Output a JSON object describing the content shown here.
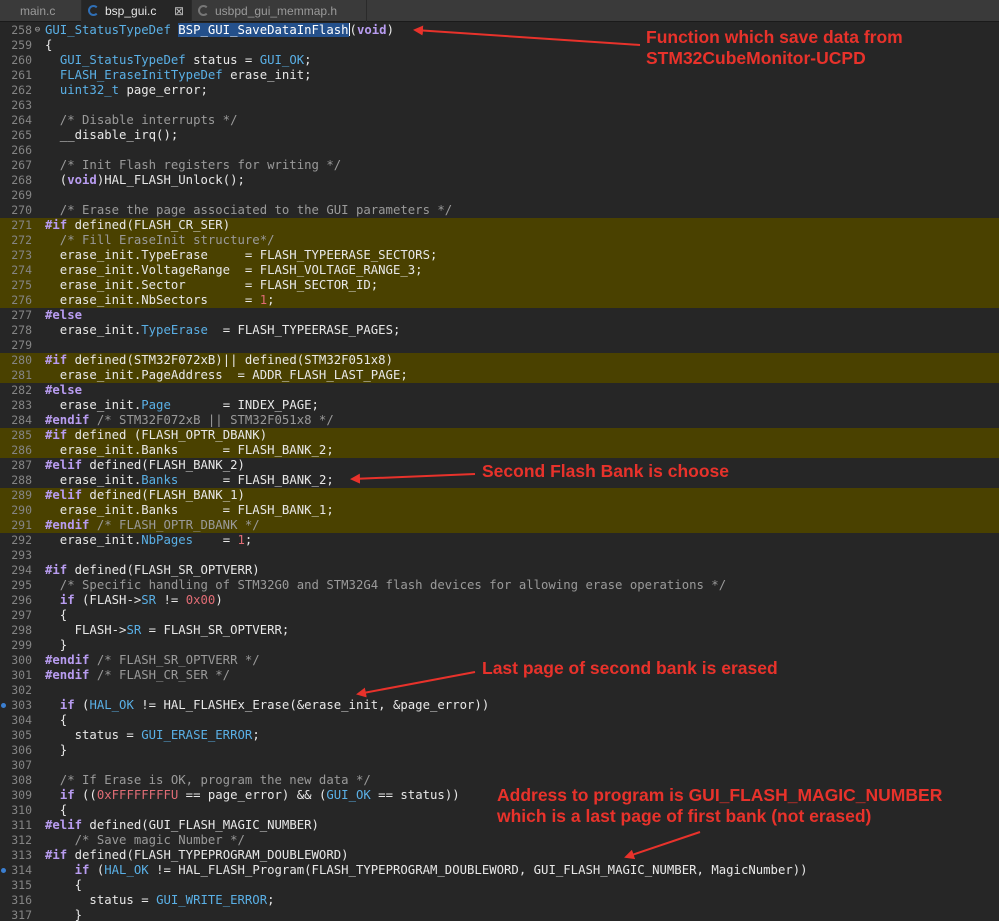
{
  "tabs": [
    {
      "label": "main.c",
      "active": false
    },
    {
      "label": "bsp_gui.c",
      "active": true,
      "close": "⊠"
    },
    {
      "label": "usbpd_gui_memmap.h",
      "active": false
    }
  ],
  "colors": {
    "highlight": "#4a4100",
    "annotation": "#e8322b",
    "keyword": "#b89cf0"
  },
  "lines": [
    {
      "n": "258",
      "m": "⊖",
      "s": [
        [
          "GUI_StatusTypeDef ",
          "ty"
        ],
        [
          "BSP_GUI_SaveDataInFlash",
          "sel"
        ],
        [
          "|",
          "caret"
        ],
        [
          "(",
          "p"
        ],
        [
          "void",
          "kw"
        ],
        [
          ")",
          "p"
        ]
      ]
    },
    {
      "n": "259",
      "s": [
        [
          "{",
          ""
        ]
      ]
    },
    {
      "n": "260",
      "s": [
        [
          "  ",
          ""
        ],
        [
          "GUI_StatusTypeDef",
          "ty"
        ],
        [
          " status = ",
          ""
        ],
        [
          "GUI_OK",
          "mac"
        ],
        [
          ";",
          ""
        ]
      ]
    },
    {
      "n": "261",
      "s": [
        [
          "  ",
          ""
        ],
        [
          "FLASH_EraseInitTypeDef",
          "ty"
        ],
        [
          " erase_init;",
          ""
        ]
      ]
    },
    {
      "n": "262",
      "s": [
        [
          "  ",
          ""
        ],
        [
          "uint32_t",
          "ty"
        ],
        [
          " page_error;",
          ""
        ]
      ]
    },
    {
      "n": "263",
      "s": []
    },
    {
      "n": "264",
      "s": [
        [
          "  /* Disable interrupts */",
          "cm"
        ]
      ]
    },
    {
      "n": "265",
      "s": [
        [
          "  __disable_irq();",
          ""
        ]
      ]
    },
    {
      "n": "266",
      "s": []
    },
    {
      "n": "267",
      "s": [
        [
          "  /* Init Flash registers for writing */",
          "cm"
        ]
      ]
    },
    {
      "n": "268",
      "s": [
        [
          "  (",
          ""
        ],
        [
          "void",
          "kw"
        ],
        [
          ")HAL_FLASH_Unlock();",
          ""
        ]
      ]
    },
    {
      "n": "269",
      "s": []
    },
    {
      "n": "270",
      "s": [
        [
          "  /* Erase the page associated to the GUI parameters */",
          "cm"
        ]
      ]
    },
    {
      "n": "271",
      "h": true,
      "s": [
        [
          "#if",
          "pp"
        ],
        [
          " defined(FLASH_CR_SER)",
          ""
        ]
      ]
    },
    {
      "n": "272",
      "h": true,
      "s": [
        [
          "  /* Fill EraseInit structure*/",
          "cm"
        ]
      ]
    },
    {
      "n": "273",
      "h": true,
      "s": [
        [
          "  erase_init.TypeErase     = FLASH_TYPEERASE_SECTORS;",
          ""
        ]
      ]
    },
    {
      "n": "274",
      "h": true,
      "s": [
        [
          "  erase_init.VoltageRange  = FLASH_VOLTAGE_RANGE_3;",
          ""
        ]
      ]
    },
    {
      "n": "275",
      "h": true,
      "s": [
        [
          "  erase_init.Sector        = FLASH_SECTOR_ID;",
          ""
        ]
      ]
    },
    {
      "n": "276",
      "h": true,
      "s": [
        [
          "  erase_init.NbSectors     = ",
          ""
        ],
        [
          "1",
          "num"
        ],
        [
          ";",
          ""
        ]
      ]
    },
    {
      "n": "277",
      "s": [
        [
          "#else",
          "pp"
        ]
      ]
    },
    {
      "n": "278",
      "s": [
        [
          "  erase_init.",
          ""
        ],
        [
          "TypeErase",
          "mac"
        ],
        [
          "  = FLASH_TYPEERASE_PAGES;",
          ""
        ]
      ]
    },
    {
      "n": "279",
      "s": []
    },
    {
      "n": "280",
      "h": true,
      "s": [
        [
          "#if",
          "pp"
        ],
        [
          " defined(STM32F072xB)|| defined(STM32F051x8)",
          ""
        ]
      ]
    },
    {
      "n": "281",
      "h": true,
      "s": [
        [
          "  erase_init.PageAddress  = ADDR_FLASH_LAST_PAGE;",
          ""
        ]
      ]
    },
    {
      "n": "282",
      "s": [
        [
          "#else",
          "pp"
        ]
      ]
    },
    {
      "n": "283",
      "s": [
        [
          "  erase_init.",
          ""
        ],
        [
          "Page",
          "mac"
        ],
        [
          "       = INDEX_PAGE;",
          ""
        ]
      ]
    },
    {
      "n": "284",
      "s": [
        [
          "#endif",
          "pp"
        ],
        [
          " /* STM32F072xB || STM32F051x8 */",
          "cm"
        ]
      ]
    },
    {
      "n": "285",
      "h": true,
      "s": [
        [
          "#if",
          "pp"
        ],
        [
          " defined (FLASH_OPTR_DBANK)",
          ""
        ]
      ]
    },
    {
      "n": "286",
      "h": true,
      "s": [
        [
          "  erase_init.Banks      = FLASH_BANK_2;",
          ""
        ]
      ]
    },
    {
      "n": "287",
      "s": [
        [
          "#elif",
          "pp"
        ],
        [
          " defined(FLASH_BANK_2)",
          ""
        ]
      ]
    },
    {
      "n": "288",
      "s": [
        [
          "  erase_init.",
          ""
        ],
        [
          "Banks",
          "mac"
        ],
        [
          "      = FLASH_BANK_2;",
          ""
        ]
      ]
    },
    {
      "n": "289",
      "h": true,
      "s": [
        [
          "#elif",
          "pp"
        ],
        [
          " defined(FLASH_BANK_1)",
          ""
        ]
      ]
    },
    {
      "n": "290",
      "h": true,
      "s": [
        [
          "  erase_init.Banks      = FLASH_BANK_1;",
          ""
        ]
      ]
    },
    {
      "n": "291",
      "h": true,
      "s": [
        [
          "#endif",
          "pp"
        ],
        [
          " /* FLASH_OPTR_DBANK */",
          "cm"
        ]
      ]
    },
    {
      "n": "292",
      "s": [
        [
          "  erase_init.",
          ""
        ],
        [
          "NbPages",
          "mac"
        ],
        [
          "    = ",
          ""
        ],
        [
          "1",
          "num"
        ],
        [
          ";",
          ""
        ]
      ]
    },
    {
      "n": "293",
      "s": []
    },
    {
      "n": "294",
      "s": [
        [
          "#if",
          "pp"
        ],
        [
          " defined(FLASH_SR_OPTVERR)",
          ""
        ]
      ]
    },
    {
      "n": "295",
      "s": [
        [
          "  /* Specific handling of STM32G0 and STM32G4 flash devices for allowing erase operations */",
          "cm"
        ]
      ]
    },
    {
      "n": "296",
      "s": [
        [
          "  ",
          ""
        ],
        [
          "if",
          "kw"
        ],
        [
          " (FLASH->",
          ""
        ],
        [
          "SR",
          "mac"
        ],
        [
          " != ",
          ""
        ],
        [
          "0x00",
          "num"
        ],
        [
          ")",
          ""
        ]
      ]
    },
    {
      "n": "297",
      "s": [
        [
          "  {",
          ""
        ]
      ]
    },
    {
      "n": "298",
      "s": [
        [
          "    FLASH->",
          ""
        ],
        [
          "SR",
          "mac"
        ],
        [
          " = FLASH_SR_OPTVERR;",
          ""
        ]
      ]
    },
    {
      "n": "299",
      "s": [
        [
          "  }",
          ""
        ]
      ]
    },
    {
      "n": "300",
      "s": [
        [
          "#endif",
          "pp"
        ],
        [
          " /* FLASH_SR_OPTVERR */",
          "cm"
        ]
      ]
    },
    {
      "n": "301",
      "s": [
        [
          "#endif",
          "pp"
        ],
        [
          " /* FLASH_CR_SER */",
          "cm"
        ]
      ]
    },
    {
      "n": "302",
      "s": []
    },
    {
      "n": "303",
      "b": true,
      "s": [
        [
          "  ",
          ""
        ],
        [
          "if",
          "kw"
        ],
        [
          " (",
          ""
        ],
        [
          "HAL_OK",
          "mac"
        ],
        [
          " != HAL_FLASHEx_Erase(&erase_init, &page_error))",
          ""
        ]
      ]
    },
    {
      "n": "304",
      "s": [
        [
          "  {",
          ""
        ]
      ]
    },
    {
      "n": "305",
      "s": [
        [
          "    status = ",
          ""
        ],
        [
          "GUI_ERASE_ERROR",
          "mac"
        ],
        [
          ";",
          ""
        ]
      ]
    },
    {
      "n": "306",
      "s": [
        [
          "  }",
          ""
        ]
      ]
    },
    {
      "n": "307",
      "s": []
    },
    {
      "n": "308",
      "s": [
        [
          "  /* If Erase is OK, program the new data */",
          "cm"
        ]
      ]
    },
    {
      "n": "309",
      "s": [
        [
          "  ",
          ""
        ],
        [
          "if",
          "kw"
        ],
        [
          " ((",
          ""
        ],
        [
          "0xFFFFFFFFU",
          "num"
        ],
        [
          " == page_error) && (",
          ""
        ],
        [
          "GUI_OK",
          "mac"
        ],
        [
          " == status))",
          ""
        ]
      ]
    },
    {
      "n": "310",
      "s": [
        [
          "  {",
          ""
        ]
      ]
    },
    {
      "n": "311",
      "s": [
        [
          "#elif",
          "pp"
        ],
        [
          " defined(GUI_FLASH_MAGIC_NUMBER)",
          ""
        ]
      ]
    },
    {
      "n": "312",
      "s": [
        [
          "    /* Save magic Number */",
          "cm"
        ]
      ]
    },
    {
      "n": "313",
      "s": [
        [
          "#if",
          "pp"
        ],
        [
          " defined(FLASH_TYPEPROGRAM_DOUBLEWORD)",
          ""
        ]
      ]
    },
    {
      "n": "314",
      "b": true,
      "s": [
        [
          "    ",
          ""
        ],
        [
          "if",
          "kw"
        ],
        [
          " (",
          ""
        ],
        [
          "HAL_OK",
          "mac"
        ],
        [
          " != HAL_FLASH_Program(FLASH_TYPEPROGRAM_DOUBLEWORD, GUI_FLASH_MAGIC_NUMBER, MagicNumber))",
          ""
        ]
      ]
    },
    {
      "n": "315",
      "s": [
        [
          "    {",
          ""
        ]
      ]
    },
    {
      "n": "316",
      "s": [
        [
          "      status = ",
          ""
        ],
        [
          "GUI_WRITE_ERROR",
          "mac"
        ],
        [
          ";",
          ""
        ]
      ]
    },
    {
      "n": "317",
      "s": [
        [
          "    }",
          ""
        ]
      ]
    }
  ],
  "annotations": [
    {
      "id": "function",
      "text": "Function which save data from\nSTM32CubeMonitor-UCPD"
    },
    {
      "id": "bank",
      "text": "Second Flash Bank is choose"
    },
    {
      "id": "erase",
      "text": "Last page of second bank is erased"
    },
    {
      "id": "address",
      "text": "Address to program is GUI_FLASH_MAGIC_NUMBER\nwhich is a last page of first bank (not erased)"
    }
  ]
}
